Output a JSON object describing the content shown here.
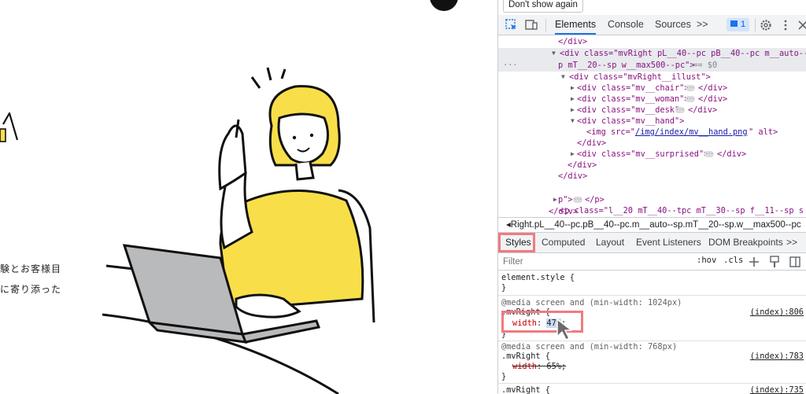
{
  "page": {
    "text_line_1": "験とお客様目",
    "text_line_2": "に寄り添った"
  },
  "devtools": {
    "dont_show_label": "Don't show again",
    "tabs": [
      "Elements",
      "Console",
      "Sources",
      ">>"
    ],
    "active_tab": "Elements",
    "issue_count": "1",
    "elements": {
      "line_close_div_top": "</div>",
      "sel_open_1": "<div class=\"mvRight pL__40--pc pB__40--pc m__auto--s",
      "sel_open_2": "p mT__20--sp w__max500--pc\">",
      "sel_eq": " == $0",
      "illust_open": "<div class=\"mvRight__illust\">",
      "chair": "<div class=\"mv__chair\">",
      "woman": "<div class=\"mv__woman\">",
      "desk": "<div class=\"mv__desk\">",
      "hand_open": "<div class=\"mv__hand\">",
      "img_pre": "<img src=\"",
      "img_src": "/img/index/mv__hand.png",
      "img_post": "\" alt>",
      "close_div": "</div>",
      "surprised": "<div class=\"mv__surprised\">",
      "p_open_1": "<p class=\"l__20 mT__40--tpc mT__30--sp f__11--sp s",
      "p_open_2": "p\">",
      "p_close": "</p>"
    },
    "breadcrumb": "◂Right.pL__40--pc.pB__40--pc.m__auto--sp.mT__20--sp.w__max500--pc",
    "style_tabs": [
      "Styles",
      "Computed",
      "Layout",
      "Event Listeners",
      "DOM Breakpoints",
      ">>"
    ],
    "active_style_tab": "Styles",
    "filter_placeholder": "Filter",
    "hov_label": ":hov",
    "cls_label": ".cls",
    "rules": {
      "element_style": "element.style {",
      "close_brace": "}",
      "media_1024": "@media screen and (min-width: 1024px)",
      "selector_1024": ".mvRight {",
      "src_1024": "(index):806",
      "prop_width": "width",
      "value_47": "47%",
      "media_768": "@media screen and (min-width: 768px)",
      "selector_768": ".mvRight {",
      "src_768": "(index):783",
      "value_65": "65%",
      "selector_base": ".mvRight {",
      "src_base": "(index):735"
    }
  },
  "colors": {
    "highlight_box": "#f07a80",
    "illustration_yellow": "#f8df4a",
    "selection_blue": "#1a73e8"
  }
}
